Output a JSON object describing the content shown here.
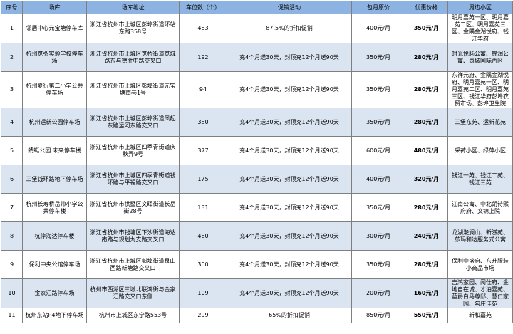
{
  "table": {
    "columns": [
      "序号",
      "场库",
      "场库地址",
      "车位数（个）",
      "促销活动",
      "包月原价",
      "优惠价格",
      "周边小区"
    ],
    "rows": [
      {
        "no": "1",
        "name": "邻居中心元宝塘停车库",
        "address": "浙江省杭州市上城区彭埠街道环站东路358号",
        "spaces": "483",
        "promo": "87.5%的折扣促销",
        "orig": "400元/月",
        "price": "350元/月",
        "nearby": "明月嘉苑一区、明月嘉苑二区、明月嘉苑三区、金隅金湖悦府、钱江华府"
      },
      {
        "no": "2",
        "name": "杭州笕弘实验学校停车场",
        "address": "浙江省杭州市上城区笕桥街道笕城路东与德胜中路交叉口",
        "spaces": "192",
        "promo": "充4个月送30天，封顶充12个月送90天",
        "orig": "350元/月",
        "price": "280元/月",
        "nearby": "时光悦肠公寓、锦润公寓、尚城国际西区"
      },
      {
        "no": "3",
        "name": "杭州夏衍第二小学公共停车场",
        "address": "浙江省杭州市上城区彭埠街道元宝塘南巷1号",
        "spaces": "94",
        "promo": "充4个月送30天，封顶充12个月送90天",
        "orig": "350元/月",
        "price": "280元/月",
        "nearby": "东祥元府、金隅金湖悦府、明月嘉苑一区、明月嘉苑二区、明月嘉苑三区、钱江华府彭埠农贸市场、彭埠卫生院"
      },
      {
        "no": "4",
        "name": "杭州运新公园停车场",
        "address": "浙江省杭州市上城区彭埠街道凤起东路运河东路交叉口",
        "spaces": "380",
        "promo": "充4个月送30天，封顶充12个月送90天",
        "orig": "350元/月",
        "price": "280元/月",
        "nearby": "三堡东苑、运新花苑"
      },
      {
        "no": "5",
        "name": "蜻蜓公园 未来停车楼",
        "address": "浙江省杭州市上城区四季青街道庆秋弄9号",
        "spaces": "377",
        "promo": "充4个月送30天，封顶充12个月送90天",
        "orig": "600元/月",
        "price": "480元/月",
        "nearby": "采荷小区、绿萍小区"
      },
      {
        "no": "6",
        "name": "三堡钱环路地下停车场",
        "address": "浙江省杭州市上城区四季青街道钱环路与平福路交叉口",
        "spaces": "175",
        "promo": "充4个月送30天，封顶充12个月送90天",
        "orig": "400元/月",
        "price": "320元/月",
        "nearby": "钱江一苑、钱江二苑、钱江三苑"
      },
      {
        "no": "7",
        "name": "杭州长寿桥岳帅小学公共停车楼",
        "address": "浙江省杭州市拱墅区文晖街道长岳街28号",
        "spaces": "131",
        "promo": "充4个月送30天，封顶充12个月送90天",
        "orig": "350元/月",
        "price": "280元/月",
        "nearby": "江南公寓、中北朗诗熙府府、文锦上院"
      },
      {
        "no": "8",
        "name": "杭停海达停车楼",
        "address": "浙江省杭州市钱塘区下沙街道海达南路与规划九支路交叉口",
        "spaces": "480",
        "promo": "充4个月送30天，封顶充12个月送90天",
        "orig": "300元/月",
        "price": "240元/月",
        "nearby": "龙湖滟澜山、新滋苑、莎玛和达服务式公寓"
      },
      {
        "no": "9",
        "name": "保利中央公馆停车场",
        "address": "浙江省杭州市上城区彭埠街道艮山西路新塘路交叉口",
        "spaces": "300",
        "promo": "充4个月送30天，封顶充12个月送90天",
        "orig": "350元/月",
        "price": "280元/月",
        "nearby": "保利中盛府、东升服装小商品市场"
      },
      {
        "no": "10",
        "name": "金家汇路停车场",
        "address": "杭州市西湖区三墩北联鸿街与金家汇路交叉口东侧",
        "spaces": "109",
        "promo": "充4个月送30天，封顶充12个月送90天",
        "orig": "200元/月",
        "price": "160元/月",
        "nearby": "吉鸿家园、阅仕府、金地自在城、才泊嘉苑、蓝爵白马尊邸、慧仁家园、勾庄佳苑"
      },
      {
        "no": "11",
        "name": "杭州东站P4地下停车场",
        "address": "杭州市上城区东宁路553号",
        "spaces": "299",
        "promo": "65%的折扣促销",
        "orig": "850元/月",
        "price": "550元/月",
        "nearby": "新和嘉苑"
      }
    ]
  }
}
